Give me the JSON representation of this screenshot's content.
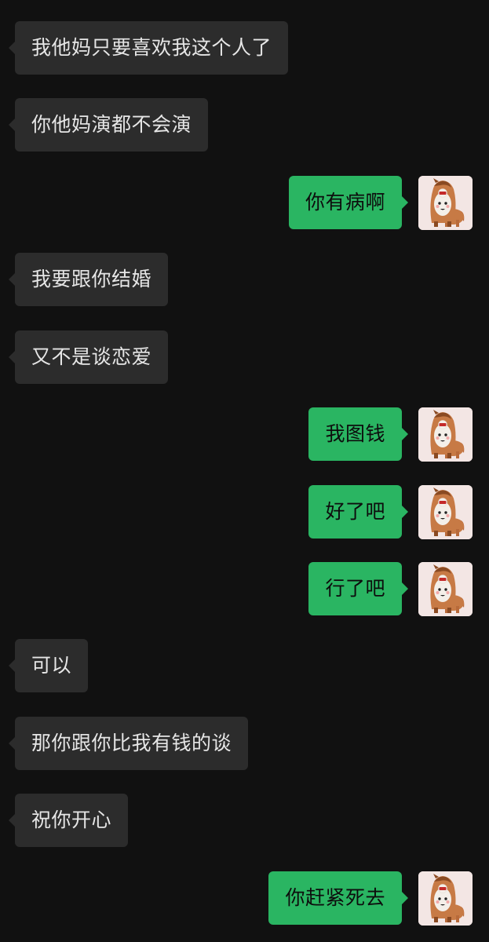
{
  "app": {
    "theme": "dark",
    "background_color": "#111111",
    "incoming_bubble_color": "#2c2c2c",
    "outgoing_bubble_color": "#2ab562"
  },
  "me": {
    "avatar_icon": "cartoon-horse-costume-avatar-icon"
  },
  "messages": [
    {
      "side": "in",
      "text": "我他妈只要喜欢我这个人了"
    },
    {
      "side": "in",
      "text": "你他妈演都不会演"
    },
    {
      "side": "out",
      "text": "你有病啊"
    },
    {
      "side": "in",
      "text": "我要跟你结婚"
    },
    {
      "side": "in",
      "text": "又不是谈恋爱"
    },
    {
      "side": "out",
      "text": "我图钱"
    },
    {
      "side": "out",
      "text": "好了吧"
    },
    {
      "side": "out",
      "text": "行了吧"
    },
    {
      "side": "in",
      "text": "可以"
    },
    {
      "side": "in",
      "text": "那你跟你比我有钱的谈"
    },
    {
      "side": "in",
      "text": "祝你开心"
    },
    {
      "side": "out",
      "text": "你赶紧死去"
    }
  ]
}
